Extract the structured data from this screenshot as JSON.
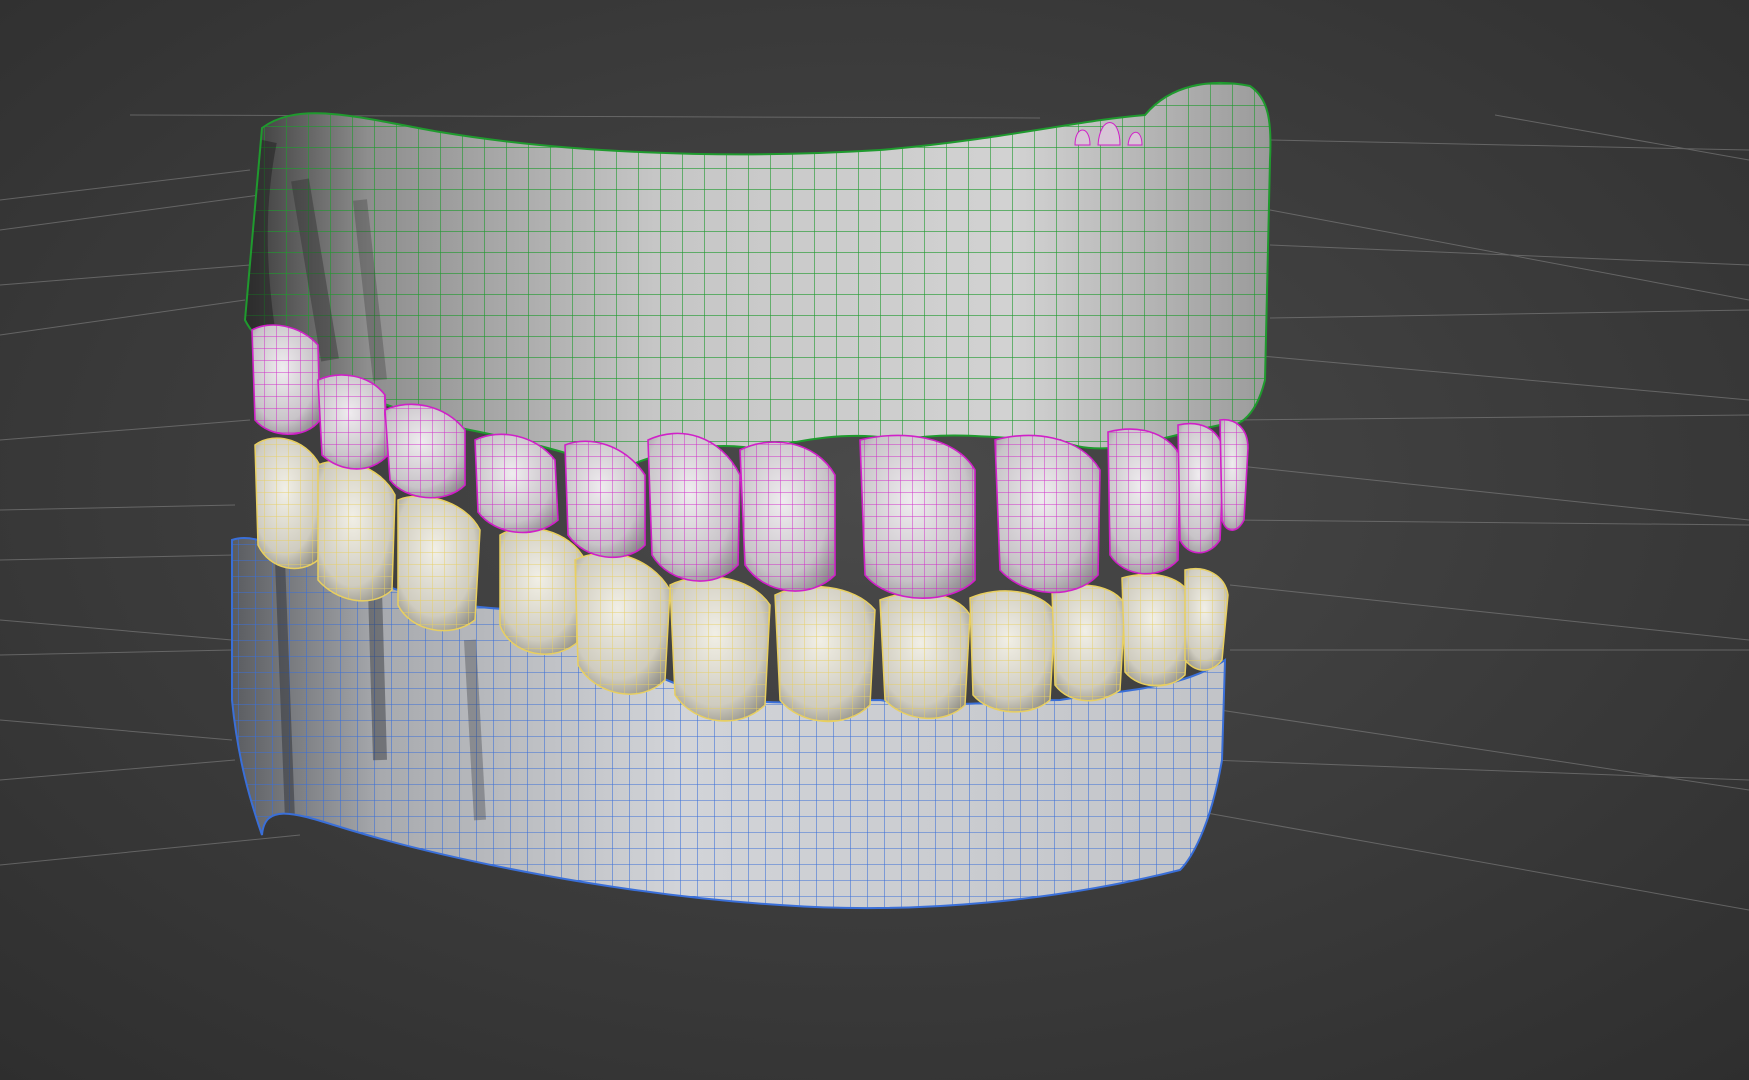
{
  "viewport": {
    "background": "#3a3a3a",
    "grid_color": "#8a8a8a"
  },
  "meshes": [
    {
      "name": "upper-gum",
      "fill": "#b7b7b7",
      "wire": "#1f9a2e"
    },
    {
      "name": "upper-teeth",
      "fill": "#d4d0d4",
      "wire": "#d020c8"
    },
    {
      "name": "lower-teeth",
      "fill": "#d8d6cc",
      "wire": "#e8cf60"
    },
    {
      "name": "lower-gum",
      "fill": "#c4c6ca",
      "wire": "#3a6fd8"
    }
  ]
}
